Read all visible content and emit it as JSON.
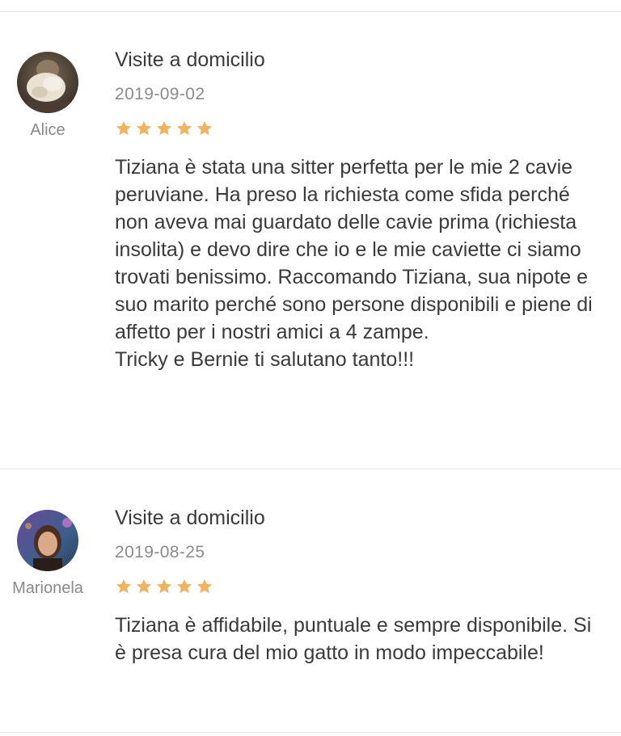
{
  "colors": {
    "star": "#f2b35f",
    "divider": "#e4e4e4",
    "text": "#3a3a3a",
    "muted": "#8a8a8a"
  },
  "reviews": [
    {
      "reviewer": "Alice",
      "avatar_icon": "user-photo-avatar",
      "service": "Visite a domicilio",
      "date": "2019-09-02",
      "rating": 5,
      "star_icon": "star-icon",
      "text": "Tiziana è stata una sitter perfetta per le mie 2 cavie peruviane. Ha preso la richiesta come sfida perché non aveva mai guardato delle cavie prima (richiesta insolita) e devo dire che io e le mie caviette ci siamo trovati benissimo. Raccomando Tiziana, sua nipote e suo marito perché sono persone disponibili e piene di affetto per i nostri amici a 4 zampe.\nTricky e Bernie ti salutano tanto!!!"
    },
    {
      "reviewer": "Marionela",
      "avatar_icon": "user-photo-avatar",
      "service": "Visite a domicilio",
      "date": "2019-08-25",
      "rating": 5,
      "star_icon": "star-icon",
      "text": "Tiziana è affidabile, puntuale e sempre disponibile. Si è presa cura del mio gatto in modo impeccabile!"
    }
  ]
}
